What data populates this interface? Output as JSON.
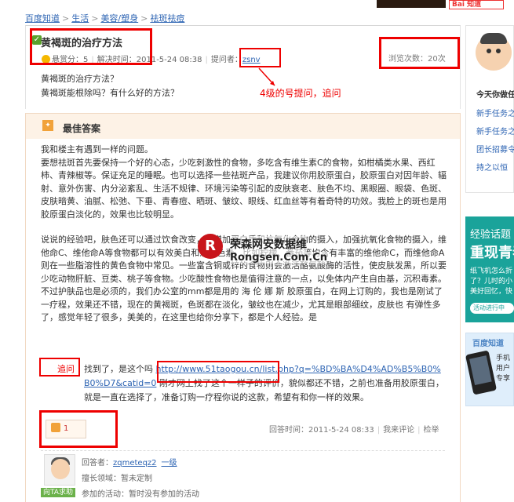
{
  "banner": {
    "right_text": "Bai 知道"
  },
  "breadcrumb": [
    "百度知道",
    "生活",
    "美容/塑身",
    "祛斑祛痘"
  ],
  "question": {
    "title": "黄褐斑的治疗方法",
    "reward_label": "悬赏分：5",
    "resolved_time": "解决时间：2011-5-24 08:38",
    "asker_label": "提问者：",
    "asker_name": "zsnv",
    "views": "浏览次数：20次",
    "body_lines": [
      "黄褐斑的治疗方法？",
      "黄褐斑能根除吗？有什么好的方法？"
    ]
  },
  "annotation": "4级的号提问，追问",
  "best_answer": {
    "heading": "最佳答案",
    "paragraphs": [
      "我和楼主有遇到一样的问题。",
      "要想祛斑首先要保持一个好的心态，少吃刺激性的食物，多吃含有维生素C的食物，如柑橘类水果、西红柿、青辣椒等。保证充足的睡眠。也可以选择一些祛斑产品，我建议你用胶原蛋白，胶原蛋白对因年龄、辐射、意外伤害、内分泌紊乱、生活不规律、环境污染等引起的皮肤衰老、肤色不均、黑眼圈、眼袋、色斑、皮肤暗黄、油腻、松弛、下垂、青春痘、晒斑、皱纹、眼线、红血丝等有着奇特的功效。我脸上的斑也是用胶原蛋白淡化的，效果也比较明显。",
      "说说的经验吧，肤色还可以通过饮食改变，宜增加蛋白质和抗氧化食物的摄入，加强抗氧化食物的摄入，维他命C、维他命A等食物都可以有效美白和淡化色素，比如柠檬、番茄等均含有丰富的维他命C，而维他命A则在一些脂溶性的黄色食物中常见。一些富含铜或锌的食物则会激活酪氨酸酶的活性，使皮肤发黑，所以要少吃动物肝脏、豆类、桃子等食物。少吃酸性食物也是值得注意的一点，以免体内产生自由基，沉积毒素。",
      "不过护肤品也是必须的，我们办公室的mm都是用的 海 伦 娜 斯 胶原蛋白，在网上订购的，我也是刚试了一疗程，效果还不错，现在的黄褐斑，色斑都在淡化，皱纹也在减少，尤其是眼部细纹，皮肤也 有弹性多了，感觉年轻了很多，美美的，在这里也给你分享下，都是个人经验。是"
    ],
    "followup_label": "追问",
    "followup_prefix": "找到了，是这个吗",
    "followup_link": "http://www.51taogou.cn/list.php?q=%BD%BA%D4%AD%B5%B0%B0%D7&catid=0",
    "followup_rest": "刚才网上找了这个一样子的评价，貌似都还不错，之前也准备用胶原蛋白，就是一直在选择了，准备订购一疗程你说的这款，希望有和你一样的效果。",
    "like_count": "1",
    "answer_time": "回答时间：2011-5-24 08:33",
    "comment": "我来评论",
    "report": "检举",
    "answerer_label": "回答者：",
    "answerer_name": "zqmeteqz2",
    "answerer_level": "一级",
    "specialty": "擅长领域：暂未定制",
    "activity": "参加的活动：暂时没有参加的活动",
    "asker_tag": "向TA求助"
  },
  "watermark": {
    "logo": "R",
    "title": "荣森网安数据维",
    "subtitle": "Rongsen.Com.Cn"
  },
  "sidebar": {
    "title": "今天你做任务了吗",
    "links": [
      "新手任务之一",
      "新手任务之二",
      "团长招募令",
      "持之以恒"
    ],
    "promo_line1": "经验话题",
    "promo_line2": "重现青春",
    "promo_line3": "纸飞机怎么折",
    "promo_line4": "了？儿时的小",
    "promo_line5": "美好回忆，快",
    "promo_button": "活动进行中",
    "ad_heading": "百度知道",
    "ad_text": [
      "手机",
      "用户",
      "专享"
    ]
  }
}
